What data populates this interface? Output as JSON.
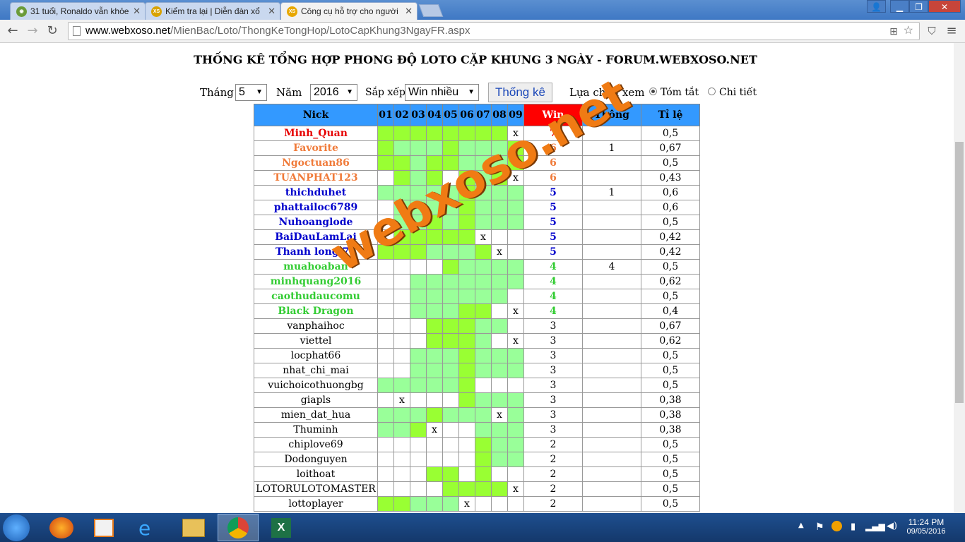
{
  "tabs": [
    {
      "label": "31 tuổi, Ronaldo vẫn khỏe",
      "active": false
    },
    {
      "label": "Kiểm tra lại | Diễn đàn xổ",
      "active": false
    },
    {
      "label": "Công cụ hỗ trợ cho người",
      "active": true
    }
  ],
  "favicon_text": "XS",
  "address": {
    "host": "www.webxoso.net",
    "path": "/MienBac/Loto/ThongKeTongHop/LotoCapKhung3NgayFR.aspx"
  },
  "page": {
    "title": "THỐNG KÊ TỔNG HỢP PHONG ĐỘ LOTO CẶP KHUNG 3 NGÀY - FORUM.WEBXOSO.NET",
    "month_label": "Tháng",
    "month_value": "5",
    "year_label": "Năm",
    "year_value": "2016",
    "sort_label": "Sắp xếp",
    "sort_value": "Win nhiều",
    "submit_label": "Thống kê",
    "view_label": "Lựa chọn xem",
    "view_summary": "Tóm tắt",
    "view_detail": "Chi tiết",
    "watermark": "webxoso.net"
  },
  "table": {
    "headers": {
      "nick": "Nick",
      "days": [
        "01",
        "02",
        "03",
        "04",
        "05",
        "06",
        "07",
        "08",
        "09"
      ],
      "win": "Win",
      "thong": "Thông",
      "ratio": "Tỉ lệ"
    },
    "rows": [
      {
        "nick": "Minh_Quan",
        "cells": "GGGGGGGGX",
        "win": "7",
        "thong": "",
        "ratio": "0,5"
      },
      {
        "nick": "Favorite",
        "cells": "GLLLGLLLG",
        "win": "6",
        "thong": "1",
        "ratio": "0,67"
      },
      {
        "nick": "Ngoctuan86",
        "cells": "GGLGGLLLG",
        "win": "6",
        "thong": "",
        "ratio": "0,5"
      },
      {
        "nick": "TUANPHAT123",
        "cells": "_GLG_GLGX",
        "win": "6",
        "thong": "",
        "ratio": "0,43"
      },
      {
        "nick": "thichduhet",
        "cells": "LLLLLGLLL",
        "win": "5",
        "thong": "1",
        "ratio": "0,6"
      },
      {
        "nick": "phattailoc6789",
        "cells": "_LLLLGLLL",
        "win": "5",
        "thong": "",
        "ratio": "0,6"
      },
      {
        "nick": "Nuhoanglode",
        "cells": "_LLGLGLLL",
        "win": "5",
        "thong": "",
        "ratio": "0,5"
      },
      {
        "nick": "BaiDauLamLai",
        "cells": "_GGGGGX__",
        "win": "5",
        "thong": "",
        "ratio": "0,42"
      },
      {
        "nick": "Thanh long 75",
        "cells": "GGGLLLGX_",
        "win": "5",
        "thong": "",
        "ratio": "0,42"
      },
      {
        "nick": "muahoaban",
        "cells": "____GLLLL",
        "win": "4",
        "thong": "4",
        "ratio": "0,5"
      },
      {
        "nick": "minhquang2016",
        "cells": "__LLLLLLL",
        "win": "4",
        "thong": "",
        "ratio": "0,62"
      },
      {
        "nick": "caothudaucomu",
        "cells": "__LLLLLL_",
        "win": "4",
        "thong": "",
        "ratio": "0,5"
      },
      {
        "nick": "Black Dragon",
        "cells": "__LLLGG_X",
        "win": "4",
        "thong": "",
        "ratio": "0,4"
      },
      {
        "nick": "vanphaihoc",
        "cells": "___GGGLL_",
        "win": "3",
        "thong": "",
        "ratio": "0,67"
      },
      {
        "nick": "viettel",
        "cells": "___GGGL_X",
        "win": "3",
        "thong": "",
        "ratio": "0,62"
      },
      {
        "nick": "locphat66",
        "cells": "__LLLGLLL",
        "win": "3",
        "thong": "",
        "ratio": "0,5"
      },
      {
        "nick": "nhat_chi_mai",
        "cells": "__LLLGLLL",
        "win": "3",
        "thong": "",
        "ratio": "0,5"
      },
      {
        "nick": "vuichoicothuongbg",
        "cells": "LLLLLG___",
        "win": "3",
        "thong": "",
        "ratio": "0,5"
      },
      {
        "nick": "giapls",
        "cells": "_X___GLLL",
        "win": "3",
        "thong": "",
        "ratio": "0,38"
      },
      {
        "nick": "mien_dat_hua",
        "cells": "LLLGLLLXL",
        "win": "3",
        "thong": "",
        "ratio": "0,38"
      },
      {
        "nick": "Thuminh",
        "cells": "LLGX__LLL",
        "win": "3",
        "thong": "",
        "ratio": "0,38"
      },
      {
        "nick": "chiplove69",
        "cells": "______GLL",
        "win": "2",
        "thong": "",
        "ratio": "0,5"
      },
      {
        "nick": "Dodonguyen",
        "cells": "______GLL",
        "win": "2",
        "thong": "",
        "ratio": "0,5"
      },
      {
        "nick": "loithoat",
        "cells": "___GG_G__",
        "win": "2",
        "thong": "",
        "ratio": "0,5"
      },
      {
        "nick": "LOTORULOTOMASTER",
        "cells": "____GGGGX",
        "win": "2",
        "thong": "",
        "ratio": "0,5"
      },
      {
        "nick": "lottoplayer",
        "cells": "GGLLLX___",
        "win": "2",
        "thong": "",
        "ratio": "0,5"
      }
    ]
  },
  "taskbar": {
    "time": "11:24 PM",
    "date": "09/05/2016"
  },
  "colors": {
    "header": "#3399ff",
    "win_header": "#ff0000",
    "green": "#99ff33",
    "light_green": "#99ff99",
    "red": "#e60000",
    "orange": "#f07b3a",
    "blue": "#0000cc",
    "mid_green": "#33cc33"
  }
}
